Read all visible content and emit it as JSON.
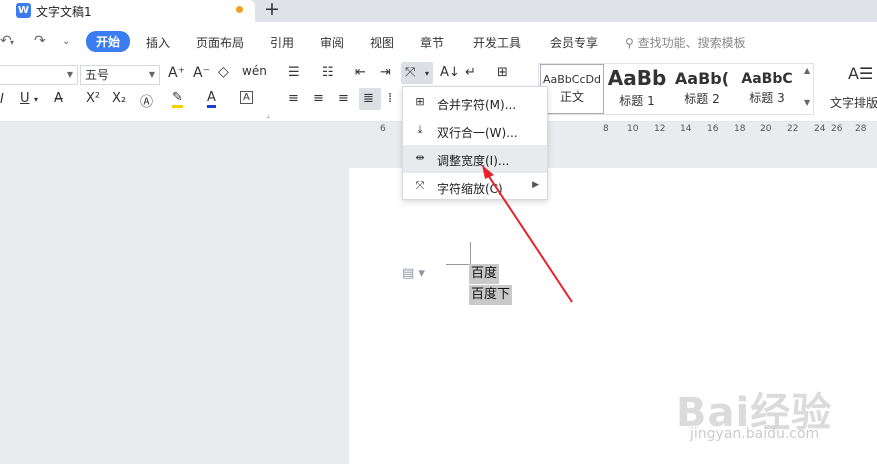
{
  "titlebar": {
    "doc_title": "文字文稿1",
    "new_tab": "+"
  },
  "menu": {
    "items": [
      "开始",
      "插入",
      "页面布局",
      "引用",
      "审阅",
      "视图",
      "章节",
      "开发工具",
      "会员专享"
    ],
    "search": "查找功能、搜索模板"
  },
  "ribbon": {
    "font_size": "五号",
    "styles": [
      {
        "sample": "AaBbCcDd",
        "label": "正文"
      },
      {
        "sample": "AaBb",
        "label": "标题 1"
      },
      {
        "sample": "AaBb(",
        "label": "标题 2"
      },
      {
        "sample": "AaBbC",
        "label": "标题 3"
      }
    ],
    "text_layout": "文字排版"
  },
  "ruler": [
    "6",
    "4",
    "6",
    "8",
    "10",
    "12",
    "14",
    "16",
    "18",
    "20",
    "22",
    "24",
    "26",
    "28"
  ],
  "dropdown": {
    "items": [
      {
        "label": "合并字符(M)...",
        "icon": "merge-chars-icon"
      },
      {
        "label": "双行合一(W)...",
        "icon": "two-lines-in-one-icon"
      },
      {
        "label": "调整宽度(I)...",
        "icon": "adjust-width-icon"
      },
      {
        "label": "字符缩放(C)",
        "icon": "char-scale-icon"
      }
    ]
  },
  "document": {
    "lines": [
      "百度",
      "百度下"
    ]
  },
  "watermark": {
    "brand": "Bai经验",
    "url": "jingyan.baidu.com"
  },
  "colors": {
    "accent": "#3b7cf0",
    "arrow": "#e8222c",
    "highlight": "#f5d300",
    "font_color": "#1c3cd6"
  }
}
